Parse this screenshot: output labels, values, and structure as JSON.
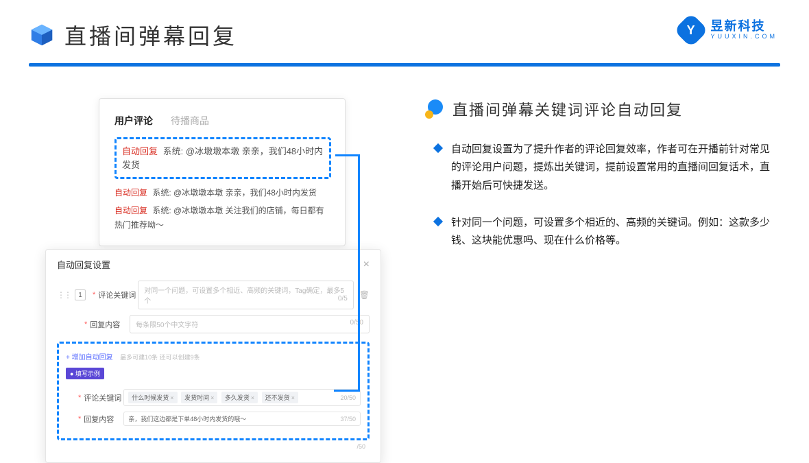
{
  "header": {
    "title": "直播间弹幕回复",
    "brand_name": "昱新科技",
    "brand_sub": "YUUXIN.COM"
  },
  "comment_card": {
    "tab_active": "用户评论",
    "tab_other": "待播商品",
    "auto_label": "自动回复",
    "system_prefix": "系统:",
    "row1": "@冰墩墩本墩 亲亲，我们48小时内发货",
    "row2": "@冰墩墩本墩 亲亲，我们48小时内发货",
    "row3": "@冰墩墩本墩 关注我们的店铺，每日都有热门推荐呦～"
  },
  "settings": {
    "title": "自动回复设置",
    "row_index": "1",
    "label_keyword": "评论关键词",
    "ph_keyword": "对同一个问题，可设置多个相近、高频的关键词，Tag确定，最多5个",
    "count_keyword": "0/5",
    "label_content": "回复内容",
    "ph_content": "每条限50个中文字符",
    "count_content": "0/50",
    "add_link": "+ 增加自动回复",
    "add_hint": "最多可建10条 还可以创建9条",
    "badge": "● 填写示例",
    "ex_label_kw": "评论关键词",
    "tags": [
      "什么时候发货",
      "发货时间",
      "多久发货",
      "还不发货"
    ],
    "ex_count_kw": "20/50",
    "ex_label_ct": "回复内容",
    "ex_content": "亲，我们这边都是下单48小时内发货的哦～",
    "ex_count_ct": "37/50",
    "trailing_count": "/50"
  },
  "right": {
    "section_title": "直播间弹幕关键词评论自动回复",
    "b1": "自动回复设置为了提升作者的评论回复效率，作者可在开播前针对常见的评论用户问题，提炼出关键词，提前设置常用的直播间回复话术，直播开始后可快捷发送。",
    "b2": "针对同一个问题，可设置多个相近的、高频的关键词。例如：这款多少钱、这块能优惠吗、现在什么价格等。"
  }
}
